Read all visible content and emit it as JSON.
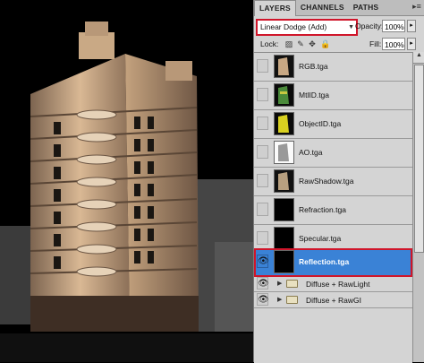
{
  "tabs": [
    {
      "label": "LAYERS",
      "active": true
    },
    {
      "label": "CHANNELS",
      "active": false
    },
    {
      "label": "PATHS",
      "active": false
    }
  ],
  "tab_menu_icon": "panel-menu-icon",
  "blend_mode": "Linear Dodge (Add)",
  "opacity_label": "Opacity:",
  "opacity_value": "100%",
  "lock_label": "Lock:",
  "fill_label": "Fill:",
  "fill_value": "100%",
  "layers": [
    {
      "name": "RGB.tga",
      "visible": false,
      "selected": false
    },
    {
      "name": "MtlID.tga",
      "visible": false,
      "selected": false
    },
    {
      "name": "ObjectID.tga",
      "visible": false,
      "selected": false
    },
    {
      "name": "AO.tga",
      "visible": false,
      "selected": false
    },
    {
      "name": "RawShadow.tga",
      "visible": false,
      "selected": false
    },
    {
      "name": "Refraction.tga",
      "visible": false,
      "selected": false
    },
    {
      "name": "Specular.tga",
      "visible": false,
      "selected": false
    },
    {
      "name": "Reflection.tga",
      "visible": true,
      "selected": true
    }
  ],
  "groups": [
    {
      "name": "Diffuse + RawLight",
      "visible": true
    },
    {
      "name": "Diffuse + RawGI",
      "visible": true
    }
  ],
  "colors": {
    "selection": "#3a82d6",
    "highlight_border": "#d0152a",
    "panel_bg": "#d4d4d4"
  }
}
